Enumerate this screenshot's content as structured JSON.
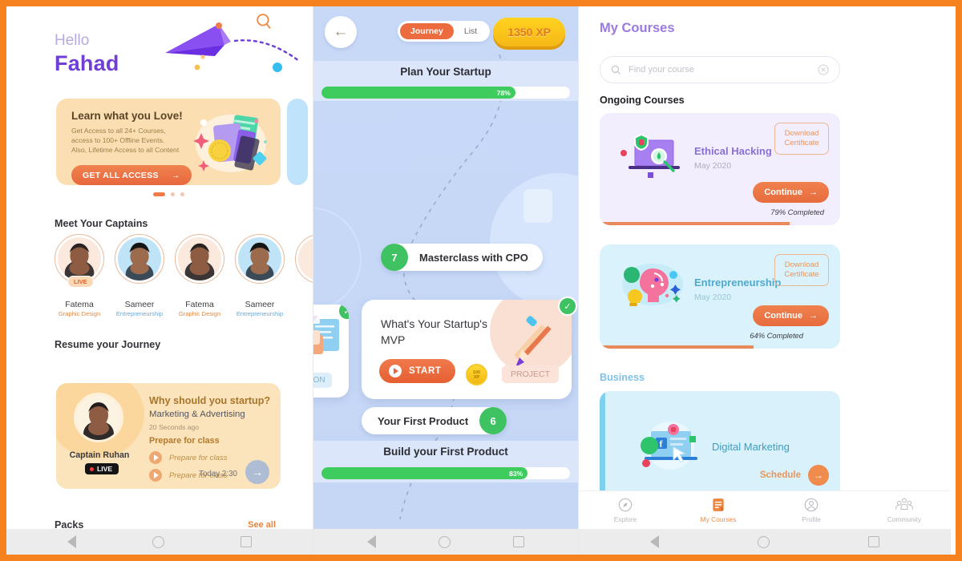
{
  "app": {
    "frame_color": "#f5821f",
    "accent_orange": "#e8693c",
    "accent_purple": "#6f3fd6",
    "accent_green": "#3fc261"
  },
  "left": {
    "greeting": "Hello",
    "username": "Fahad",
    "search_icon": "search-icon",
    "banner": {
      "title": "Learn what you Love!",
      "line1": "Get Access to all 24+ Courses,",
      "line2": "access to 100+ Offline Events.",
      "line3": "Also, Lifetime Access to all Content",
      "cta": "GET ALL ACCESS",
      "dots": 3,
      "active_dot": 0
    },
    "captains_heading": "Meet Your Captains",
    "captains": [
      {
        "name": "Fatema",
        "role": "Graphic Design",
        "live": "LIVE",
        "role_tone": "o"
      },
      {
        "name": "Sameer",
        "role": "Entrepreneurship",
        "live": "",
        "role_tone": "b"
      },
      {
        "name": "Fatema",
        "role": "Graphic Design",
        "live": "",
        "role_tone": "o"
      },
      {
        "name": "Sameer",
        "role": "Entrepreneurship",
        "live": "",
        "role_tone": "b"
      }
    ],
    "resume_heading": "Resume your Journey",
    "resume": {
      "captain_name": "Captain Ruhan",
      "live_badge": "LIVE",
      "title": "Why should you startup?",
      "category": "Marketing & Advertising",
      "ago": "20 Seconds ago",
      "prepare_heading": "Prepare for class",
      "items": [
        "Prepare for class",
        "Prepare for class"
      ],
      "time": "Today 2:30"
    },
    "packs_heading": "Packs",
    "see_all": "See all"
  },
  "middle": {
    "back_icon": "back-arrow-icon",
    "segments": [
      {
        "label": "Journey",
        "active": true
      },
      {
        "label": "List",
        "active": false
      }
    ],
    "xp_badge": "1350 XP",
    "top_section": {
      "title": "Plan Your Startup",
      "percent": "78%",
      "value": 78
    },
    "bottom_section": {
      "title": "Build your First Product",
      "percent": "83%",
      "value": 83
    },
    "nodes": [
      {
        "num": "7",
        "label": "Masterclass with CPO",
        "side": "left"
      },
      {
        "num": "6",
        "label": "Your First Product",
        "side": "right"
      }
    ],
    "mvp_card": {
      "title": "What's Your Startup's MVP",
      "start_label": "START",
      "coin_value": "100",
      "coin_unit": "XP",
      "tag": "PROJECT",
      "completed": true
    },
    "side_card": {
      "tag": "LESSON",
      "completed": true
    },
    "whatsapp_icon": "whatsapp-icon"
  },
  "right": {
    "title": "My Courses",
    "search": {
      "placeholder": "Find your course",
      "value": "",
      "search_icon": "search-icon",
      "clear_icon": "clear-icon"
    },
    "ongoing_heading": "Ongoing Courses",
    "courses": [
      {
        "name": "Ethical Hacking",
        "date": "May 2020",
        "download_label": "Download Certificate",
        "continue_label": "Continue",
        "completed_text": "79% Completed",
        "percent": 79,
        "bg": "#f3eefd",
        "name_color": "#8a6fd6",
        "date_color": "#b0abc4",
        "art": "laptop-shield-icon"
      },
      {
        "name": "Entrepreneurship",
        "date": "May 2020",
        "download_label": "Download Certificate",
        "continue_label": "Continue",
        "completed_text": "64% Completed",
        "percent": 64,
        "bg": "#d9f2fb",
        "name_color": "#50a9cc",
        "date_color": "#96c8dd",
        "art": "brain-idea-icon"
      }
    ],
    "business_heading": "Business",
    "business_course": {
      "name": "Digital Marketing",
      "schedule_label": "Schedule",
      "art": "laptop-social-icon"
    },
    "tabs": [
      {
        "label": "Explore",
        "icon": "compass-icon",
        "active": false
      },
      {
        "label": "My Courses",
        "icon": "book-icon",
        "active": true
      },
      {
        "label": "Profile",
        "icon": "person-icon",
        "active": false
      },
      {
        "label": "Community",
        "icon": "people-icon",
        "active": false
      }
    ]
  },
  "system_nav": {
    "back_icon": "android-back-icon",
    "home_icon": "android-home-icon",
    "recents_icon": "android-recents-icon"
  }
}
